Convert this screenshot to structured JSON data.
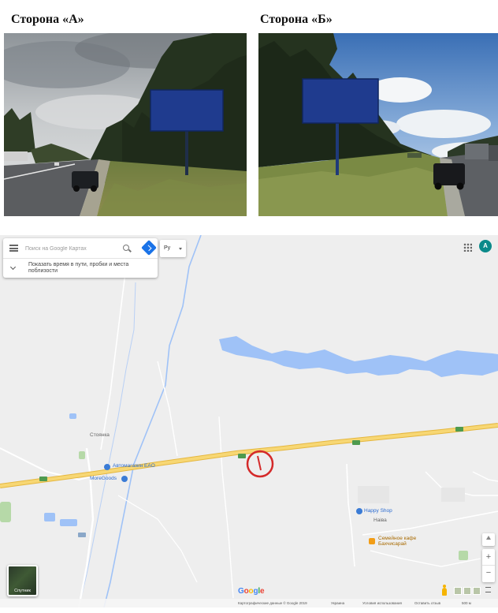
{
  "photos": {
    "side_a_title": "Сторона «А»",
    "side_b_title": "Сторона «Б»"
  },
  "map": {
    "search": {
      "placeholder": "Поиск на Google Картах",
      "expand_hint": "Показать время в пути, пробки и места поблизости"
    },
    "language": "Ру",
    "account_initial": "A",
    "satellite_label": "Спутник",
    "zoom_in": "+",
    "zoom_out": "−",
    "place_labels": {
      "village": "Стоянка",
      "gas_station": "Автомагазин EAO",
      "moregoods": "MoreGoods",
      "happy_shop": "Happy Shop",
      "naiva": "Наiва",
      "cafe": "Семейное кафе Бахчисарай"
    },
    "google_logo": "Google",
    "attribution": {
      "data": "Картографические данные © Google 2019",
      "country": "Украина",
      "terms": "Условия использования",
      "feedback": "Оставить отзыв",
      "scale": "500 м"
    },
    "colors": {
      "land": "#eeeeee",
      "water": "#9fc2f7",
      "highway": "#f7d774",
      "highway_edge": "#e5b73f",
      "marker": "#d42a2a",
      "account": "#0b8a8a"
    },
    "icons": [
      "menu-icon",
      "search-icon",
      "directions-icon",
      "chevron-down-icon",
      "apps-icon",
      "compass-icon",
      "pegman-icon",
      "expand-arrows-icon"
    ]
  }
}
